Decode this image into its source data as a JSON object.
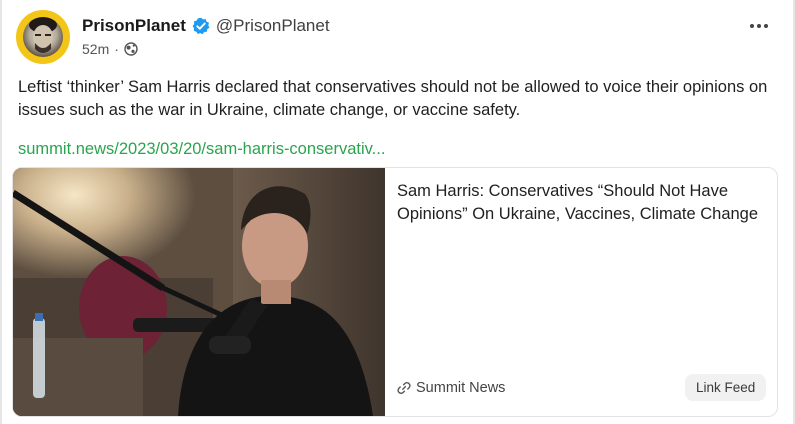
{
  "post": {
    "author": {
      "display_name": "PrisonPlanet",
      "handle": "@PrisonPlanet",
      "verified_icon": "verified-badge-icon"
    },
    "timestamp": "52m",
    "separator": "·",
    "visibility_icon": "globe-icon",
    "more_icon": "more-horizontal-icon",
    "text": "Leftist ‘thinker’ Sam Harris declared that conservatives should not be allowed to voice their opinions on issues such as the war in Ukraine, climate change, or vaccine safety.",
    "link_text": "summit.news/2023/03/20/sam-harris-conservativ...",
    "link_color": "#2aa44f",
    "accent": "#f3c516",
    "verified_color": "#1d9bf0"
  },
  "card": {
    "title": "Sam Harris: Conservatives “Should Not Have Opinions” On Ukraine, Vaccines, Climate Change",
    "source": "Summit News",
    "source_icon": "link-icon",
    "badge": "Link Feed"
  }
}
